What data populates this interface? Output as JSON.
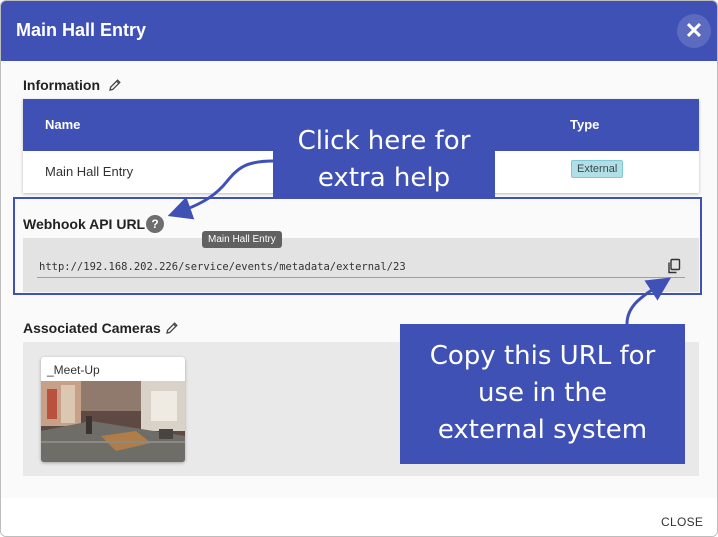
{
  "dialog": {
    "title": "Main Hall Entry",
    "close_label": "CLOSE"
  },
  "information": {
    "label": "Information",
    "columns": [
      "Name",
      "Type"
    ],
    "row": {
      "name": "Main Hall Entry",
      "type": "External"
    }
  },
  "webhook": {
    "label": "Webhook API URL",
    "help_symbol": "?",
    "url": "http://192.168.202.226/service/events/metadata/external/23",
    "tooltip": "Main Hall Entry"
  },
  "cameras": {
    "label": "Associated Cameras",
    "items": [
      {
        "name": "_Meet-Up"
      }
    ]
  },
  "callouts": {
    "help": [
      "Click here for",
      "extra help"
    ],
    "copy": [
      "Copy this URL for",
      "use in the",
      "external system"
    ]
  },
  "colors": {
    "primary": "#3f51b5",
    "badge": "#b2dfe6"
  },
  "icons": {
    "close": "close-icon",
    "edit": "pencil-icon",
    "copy": "copy-icon",
    "help": "help-icon"
  }
}
